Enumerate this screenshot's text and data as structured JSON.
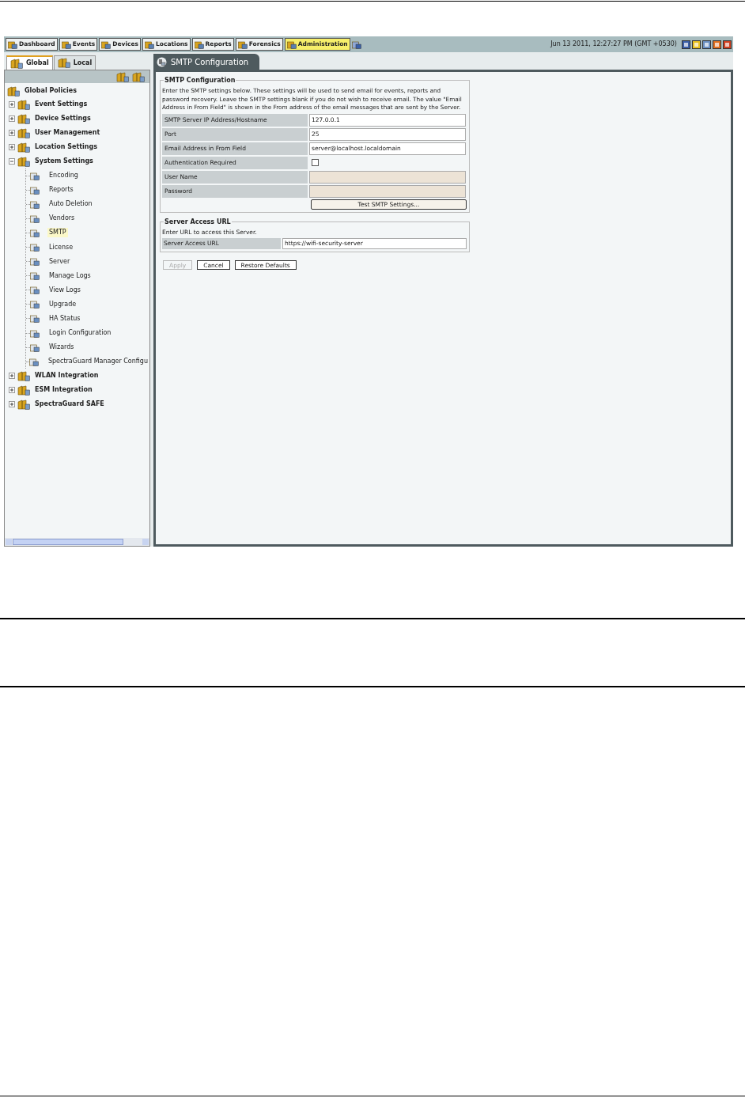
{
  "nav_tabs": [
    {
      "label": "Dashboard",
      "selected": false
    },
    {
      "label": "Events",
      "selected": false
    },
    {
      "label": "Devices",
      "selected": false
    },
    {
      "label": "Locations",
      "selected": false
    },
    {
      "label": "Reports",
      "selected": false
    },
    {
      "label": "Forensics",
      "selected": false
    },
    {
      "label": "Administration",
      "selected": true
    }
  ],
  "datetime": "Jun 13 2011, 12:27:27 PM (GMT +0530)",
  "scope_tabs": [
    {
      "label": "Global",
      "selected": true
    },
    {
      "label": "Local",
      "selected": false
    }
  ],
  "tree": {
    "label": "Global Policies",
    "children": [
      {
        "label": "Event Settings",
        "expanded": false
      },
      {
        "label": "Device Settings",
        "expanded": false
      },
      {
        "label": "User Management",
        "expanded": false
      },
      {
        "label": "Location Settings",
        "expanded": false
      },
      {
        "label": "System Settings",
        "expanded": true,
        "children": [
          {
            "label": "Encoding",
            "selected": false
          },
          {
            "label": "Reports",
            "selected": false
          },
          {
            "label": "Auto Deletion",
            "selected": false
          },
          {
            "label": "Vendors",
            "selected": false
          },
          {
            "label": "SMTP",
            "selected": true
          },
          {
            "label": "License",
            "selected": false
          },
          {
            "label": "Server",
            "selected": false
          },
          {
            "label": "Manage Logs",
            "selected": false
          },
          {
            "label": "View Logs",
            "selected": false
          },
          {
            "label": "Upgrade",
            "selected": false
          },
          {
            "label": "HA Status",
            "selected": false
          },
          {
            "label": "Login Configuration",
            "selected": false
          },
          {
            "label": "Wizards",
            "selected": false
          },
          {
            "label": "SpectraGuard Manager Configu",
            "selected": false
          }
        ]
      },
      {
        "label": "WLAN Integration",
        "expanded": false
      },
      {
        "label": "ESM Integration",
        "expanded": false
      },
      {
        "label": "SpectraGuard SAFE",
        "expanded": false
      }
    ]
  },
  "content_tab": "SMTP Configuration",
  "smtp_section": {
    "title": "SMTP Configuration",
    "description": "Enter the SMTP settings below. These settings will be used to send email for events, reports and password recovery. Leave the SMTP settings blank if you do not wish to receive email. The value \"Email Address in From Field\" is shown in the From address of the email messages that are sent by the Server.",
    "fields": [
      {
        "kind": "text",
        "label": "SMTP Server IP Address/Hostname",
        "value": "127.0.0.1",
        "disabled": false
      },
      {
        "kind": "text",
        "label": "Port",
        "value": "25",
        "disabled": false
      },
      {
        "kind": "text",
        "label": "Email Address in From Field",
        "value": "server@localhost.localdomain",
        "disabled": false
      },
      {
        "kind": "checkbox",
        "label": "Authentication Required",
        "checked": false
      },
      {
        "kind": "text",
        "label": "User Name",
        "disabled": true
      },
      {
        "kind": "text",
        "label": "Password",
        "disabled": true
      }
    ],
    "test_button": "Test SMTP Settings..."
  },
  "url_section": {
    "title": "Server Access URL",
    "description": "Enter URL to access this Server.",
    "field": {
      "label": "Server Access URL",
      "value": "https://wifi-security-server"
    }
  },
  "buttons": [
    {
      "label": "Apply",
      "disabled": true
    },
    {
      "label": "Cancel",
      "disabled": false
    },
    {
      "label": "Restore Defaults",
      "disabled": false
    }
  ]
}
